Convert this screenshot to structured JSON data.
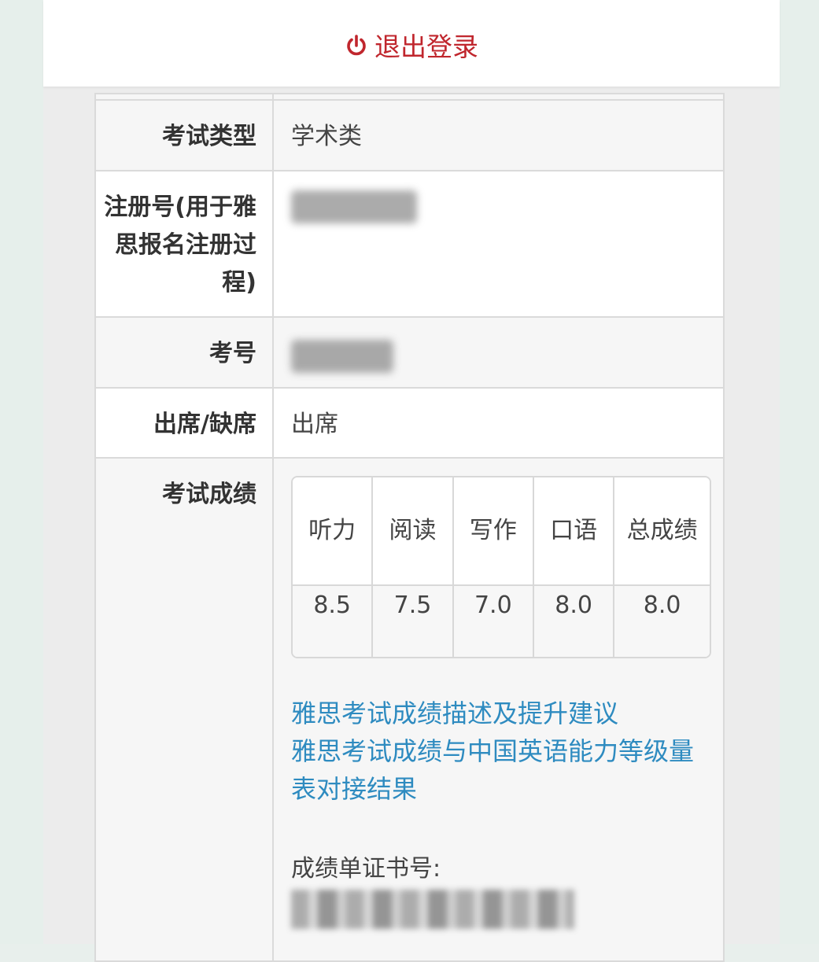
{
  "header": {
    "logout_label": "退出登录",
    "logout_icon": "power-icon",
    "logout_color": "#c0262d"
  },
  "fields": {
    "exam_type": {
      "label": "考试类型",
      "value": "学术类"
    },
    "registration_number": {
      "label": "注册号(用于雅思报名注册过程)",
      "value": ""
    },
    "candidate_number": {
      "label": "考号",
      "value": ""
    },
    "attendance": {
      "label": "出席/缺席",
      "value": "出席"
    },
    "scores": {
      "label": "考试成绩"
    }
  },
  "score_table": {
    "headers": [
      "听力",
      "阅读",
      "写作",
      "口语",
      "总成绩"
    ],
    "values": [
      "8.5",
      "7.5",
      "7.0",
      "8.0",
      "8.0"
    ]
  },
  "links": [
    "雅思考试成绩描述及提升建议",
    "雅思考试成绩与中国英语能力等级量表对接结果"
  ],
  "certificate": {
    "label": "成绩单证书号:",
    "value": ""
  },
  "link_color": "#2e8bc0"
}
